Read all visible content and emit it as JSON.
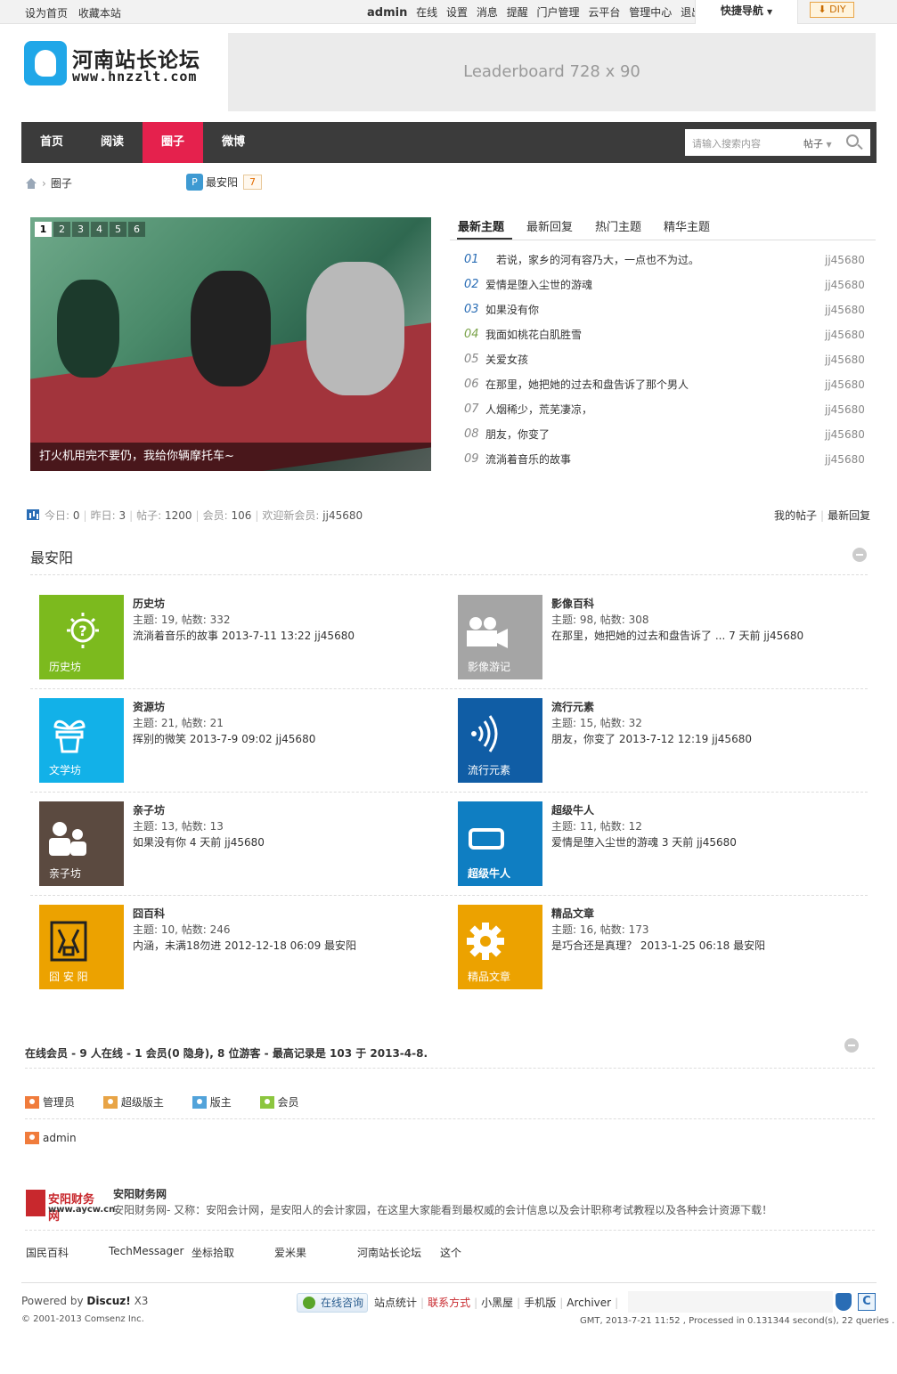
{
  "topbar": {
    "left_links": [
      "设为首页",
      "收藏本站"
    ],
    "user": "admin",
    "user_links": [
      "在线",
      "设置",
      "消息",
      "提醒",
      "门户管理",
      "云平台",
      "管理中心",
      "退出"
    ],
    "quick_nav": "快捷导航",
    "diy": "DIY"
  },
  "header": {
    "logo_title": "河南站长论坛",
    "logo_url": "www.hnzzlt.com",
    "leaderboard": "Leaderboard 728 x 90"
  },
  "nav": {
    "items": [
      "首页",
      "阅读",
      "圈子",
      "微博"
    ],
    "active": "圈子",
    "search_placeholder": "请输入搜索内容",
    "search_type": "帖子"
  },
  "breadcrumb": {
    "current": "圈子",
    "circle_name": "最安阳",
    "circle_count": "7"
  },
  "slider": {
    "pages": [
      "1",
      "2",
      "3",
      "4",
      "5",
      "6"
    ],
    "active_page": "1",
    "caption": "打火机用完不要仍，我给你辆摩托车~"
  },
  "thread_tabs": [
    "最新主题",
    "最新回复",
    "热门主题",
    "精华主题"
  ],
  "threads": [
    {
      "num": "01",
      "subject": "若说，家乡的河有容乃大，一点也不为过。",
      "author": "jj45680"
    },
    {
      "num": "02",
      "subject": "爱情是堕入尘世的游魂",
      "author": "jj45680"
    },
    {
      "num": "03",
      "subject": "如果没有你",
      "author": "jj45680"
    },
    {
      "num": "04",
      "subject": "我面如桃花白肌胜雪",
      "author": "jj45680"
    },
    {
      "num": "05",
      "subject": "关爱女孩",
      "author": "jj45680"
    },
    {
      "num": "06",
      "subject": "在那里，她把她的过去和盘告诉了那个男人",
      "author": "jj45680"
    },
    {
      "num": "07",
      "subject": "人烟稀少，荒芜凄凉，",
      "author": "jj45680"
    },
    {
      "num": "08",
      "subject": "朋友，你变了",
      "author": "jj45680"
    },
    {
      "num": "09",
      "subject": "流淌着音乐的故事",
      "author": "jj45680"
    }
  ],
  "stats": {
    "today_label": "今日:",
    "today": "0",
    "yesterday_label": "昨日:",
    "yesterday": "3",
    "posts_label": "帖子:",
    "posts": "1200",
    "members_label": "会员:",
    "members": "106",
    "newest_label": "欢迎新会员:",
    "newest": "jj45680",
    "right_links": [
      "我的帖子",
      "最新回复"
    ]
  },
  "section_title": "最安阳",
  "forums": [
    {
      "name": "历史坊",
      "meta": "主题: 19, 帖数: 332",
      "last": "流淌着音乐的故事 2013-7-11 13:22 jj45680",
      "tile_label": "历史坊",
      "color": "#7cba1e",
      "icon": "bulb-icon"
    },
    {
      "name": "影像百科",
      "meta": "主题: 98, 帖数: 308",
      "last": "在那里，她把她的过去和盘告诉了 ... 7 天前 jj45680",
      "tile_label": "影像游记",
      "color": "#a5a5a5",
      "icon": "camera-icon"
    },
    {
      "name": "资源坊",
      "meta": "主题: 21, 帖数: 21",
      "last": "挥别的微笑 2013-7-9 09:02 jj45680",
      "tile_label": "文学坊",
      "color": "#12b1e8",
      "icon": "plant-icon"
    },
    {
      "name": "流行元素",
      "meta": "主题: 15, 帖数: 32",
      "last": "朋友，你变了 2013-7-12 12:19 jj45680",
      "tile_label": "流行元素",
      "color": "#105da5",
      "icon": "signal-icon"
    },
    {
      "name": "亲子坊",
      "meta": "主题: 13, 帖数: 13",
      "last": "如果没有你 4 天前 jj45680",
      "tile_label": "亲子坊",
      "color": "#5b4a40",
      "icon": "people-icon"
    },
    {
      "name": "超级牛人",
      "meta": "主题: 11, 帖数: 12",
      "last": "爱情是堕入尘世的游魂 3 天前 jj45680",
      "tile_label": "超级牛人",
      "color": "#0f7ec2",
      "icon": "screen-icon"
    },
    {
      "name": "囧百科",
      "meta": "主题: 10, 帖数: 246",
      "last": "内涵，未满18勿进 2012-12-18 06:09 最安阳",
      "tile_label": "囧 安 阳",
      "color": "#eca200",
      "icon": "jiong-icon"
    },
    {
      "name": "精品文章",
      "meta": "主题: 16, 帖数: 173",
      "last": "是巧合还是真理？ 2013-1-25 06:18 最安阳",
      "tile_label": "精品文章",
      "color": "#eca200",
      "icon": "gear-icon"
    }
  ],
  "online": {
    "summary": "在线会员 - 9 人在线 - 1 会员(0 隐身), 8 位游客 - 最高记录是 103 于 2013-4-8.",
    "legend": [
      {
        "label": "管理员",
        "color": "#f07c3c"
      },
      {
        "label": "超级版主",
        "color": "#e8a446"
      },
      {
        "label": "版主",
        "color": "#52a3da"
      },
      {
        "label": "会员",
        "color": "#8cc63f"
      }
    ],
    "user": "admin"
  },
  "friend_link": {
    "logo_t1": "安阳财务网",
    "logo_t2": "www.aycw.cn",
    "name": "安阳财务网",
    "desc": "安阳财务网- 又称：安阳会计网，是安阳人的会计家园，在这里大家能看到最权威的会计信息以及会计职称考试教程以及各种会计资源下载！",
    "text_links": [
      "国民百科",
      "TechMessager",
      "坐标拾取",
      "爱米果",
      "河南站长论坛",
      "这个"
    ]
  },
  "footer": {
    "powered_prefix": "Powered by",
    "powered_name": "Discuz!",
    "powered_version": "X3",
    "copyright": "© 2001-2013 Comsenz Inc.",
    "consult": "在线咨询",
    "links": [
      "站点统计",
      "联系方式",
      "小黑屋",
      "手机版",
      "Archiver"
    ],
    "status": "GMT, 2013-7-21 11:52 , Processed in 0.131344 second(s), 22 queries ."
  }
}
